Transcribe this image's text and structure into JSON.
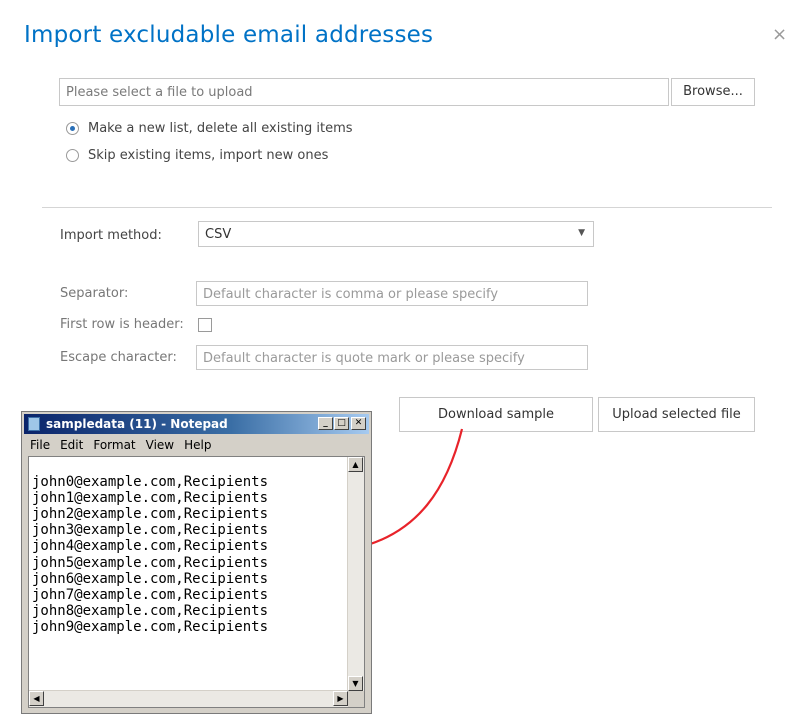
{
  "dialog": {
    "title": "Import excludable email addresses",
    "close_glyph": "×"
  },
  "upload": {
    "placeholder": "Please select a file to upload",
    "browse_label": "Browse..."
  },
  "options": [
    {
      "label": "Make a new list, delete all existing items",
      "checked": true
    },
    {
      "label": "Skip existing items, import new ones",
      "checked": false
    }
  ],
  "import_method": {
    "label": "Import method:",
    "value": "CSV"
  },
  "separator": {
    "label": "Separator:",
    "placeholder": "Default character is comma or please specify"
  },
  "first_row_header": {
    "label": "First row is header:",
    "checked": false
  },
  "escape_character": {
    "label": "Escape character:",
    "placeholder": "Default character is quote mark or please specify"
  },
  "buttons": {
    "download_sample": "Download sample",
    "upload_selected": "Upload selected file"
  },
  "notepad": {
    "title": "sampledata (11) - Notepad",
    "menu": [
      "File",
      "Edit",
      "Format",
      "View",
      "Help"
    ],
    "lines": [
      "john0@example.com,Recipients",
      "john1@example.com,Recipients",
      "john2@example.com,Recipients",
      "john3@example.com,Recipients",
      "john4@example.com,Recipients",
      "john5@example.com,Recipients",
      "john6@example.com,Recipients",
      "john7@example.com,Recipients",
      "john8@example.com,Recipients",
      "john9@example.com,Recipients"
    ]
  },
  "colors": {
    "title_blue": "#0072c6",
    "arrow_red": "#e8232a"
  }
}
